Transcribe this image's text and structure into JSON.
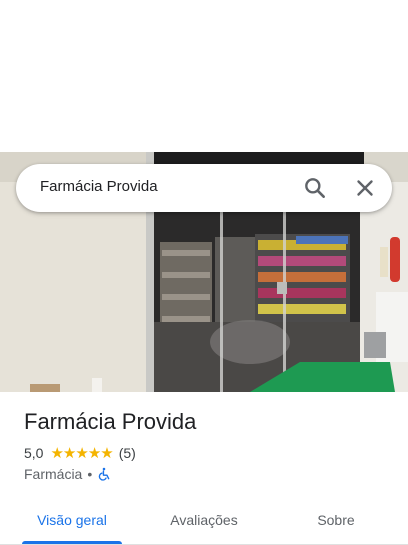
{
  "search": {
    "query": "Farmácia Provida"
  },
  "icons": {
    "search": "search-icon",
    "close": "close-icon",
    "accessibility": "wheelchair-icon",
    "star": "star-icon"
  },
  "place": {
    "name": "Farmácia Provida",
    "rating": "5,0",
    "stars": 5,
    "review_count": "(5)",
    "category": "Farmácia",
    "separator": "•"
  },
  "tabs": [
    {
      "label": "Visão geral",
      "active": true
    },
    {
      "label": "Avaliações",
      "active": false
    },
    {
      "label": "Sobre",
      "active": false
    }
  ],
  "colors": {
    "accent": "#1a73e8",
    "star": "#f4b400",
    "text": "#202124",
    "muted": "#5f6368"
  }
}
